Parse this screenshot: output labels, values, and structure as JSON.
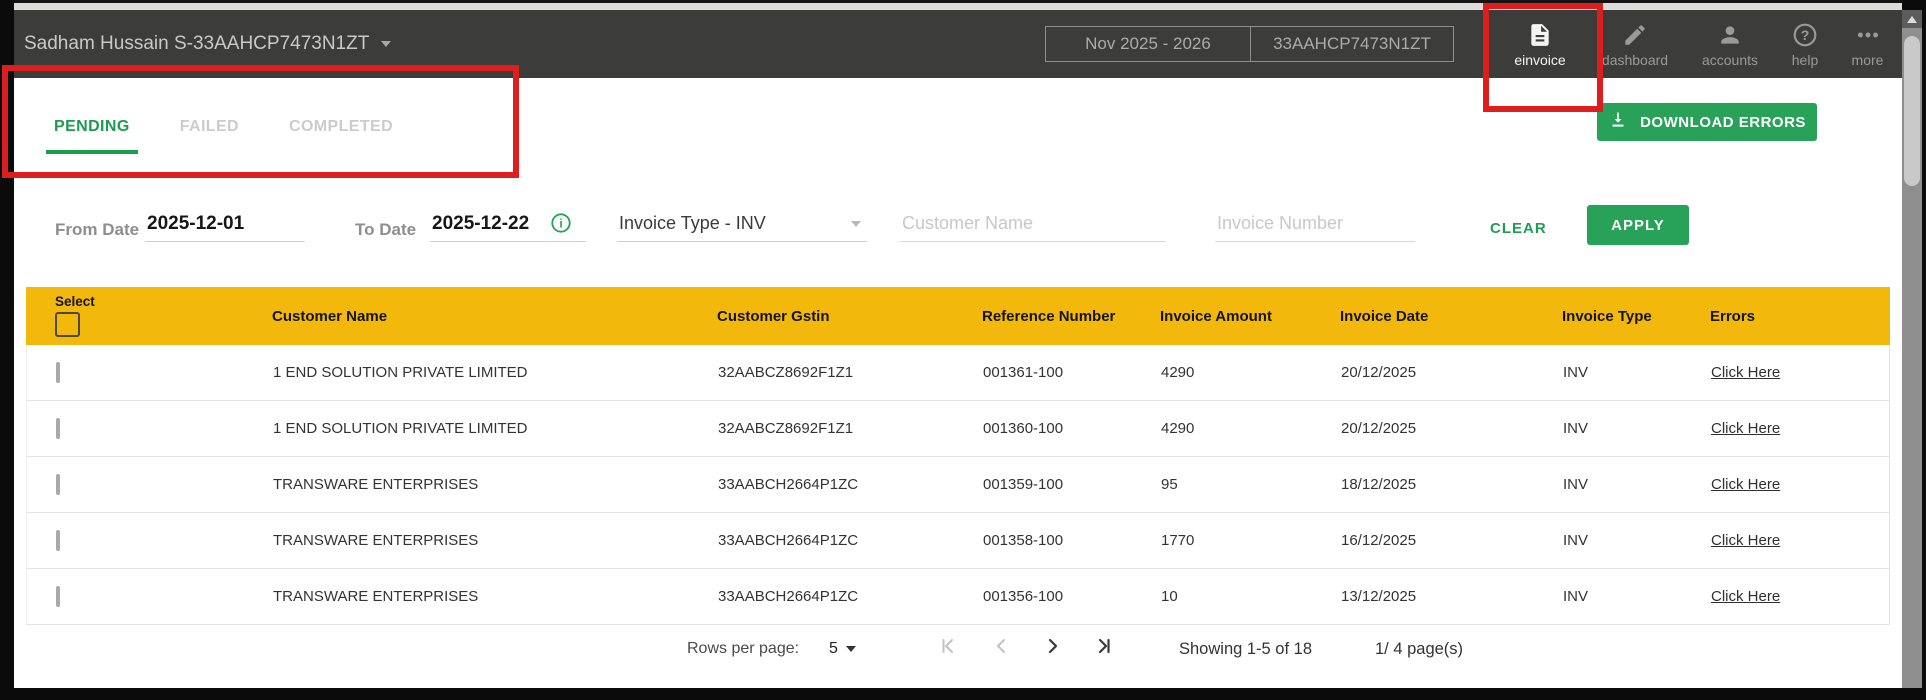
{
  "header": {
    "org_name": "Sadham Hussain S-33AAHCP7473N1ZT",
    "period": "Nov 2025 - 2026",
    "gstin": "33AAHCP7473N1ZT",
    "nav": [
      {
        "label": "einvoice",
        "icon": "document-icon",
        "active": true
      },
      {
        "label": "dashboard",
        "icon": "pencil-icon",
        "active": false
      },
      {
        "label": "accounts",
        "icon": "person-icon",
        "active": false
      },
      {
        "label": "help",
        "icon": "question-circle-icon",
        "active": false
      },
      {
        "label": "more",
        "icon": "ellipsis-icon",
        "active": false
      }
    ]
  },
  "tabs": [
    {
      "label": "PENDING",
      "active": true
    },
    {
      "label": "FAILED",
      "active": false
    },
    {
      "label": "COMPLETED",
      "active": false
    }
  ],
  "toolbar": {
    "download_errors_label": "DOWNLOAD ERRORS"
  },
  "filters": {
    "from_date_label": "From Date",
    "from_date_value": "2025-12-01",
    "to_date_label": "To Date",
    "to_date_value": "2025-12-22",
    "invoice_type_value": "Invoice Type - INV",
    "customer_name_placeholder": "Customer Name",
    "invoice_number_placeholder": "Invoice Number",
    "clear_label": "CLEAR",
    "apply_label": "APPLY"
  },
  "table": {
    "columns": [
      "Select",
      "Customer Name",
      "Customer Gstin",
      "Reference Number",
      "Invoice Amount",
      "Invoice Date",
      "Invoice Type",
      "Errors"
    ],
    "rows": [
      {
        "customer": "1 END SOLUTION PRIVATE LIMITED",
        "gstin": "32AABCZ8692F1Z1",
        "reference": "001361-100",
        "amount": "4290",
        "date": "20/12/2025",
        "type": "INV",
        "errors_link": "Click Here"
      },
      {
        "customer": "1 END SOLUTION PRIVATE LIMITED",
        "gstin": "32AABCZ8692F1Z1",
        "reference": "001360-100",
        "amount": "4290",
        "date": "20/12/2025",
        "type": "INV",
        "errors_link": "Click Here"
      },
      {
        "customer": "TRANSWARE ENTERPRISES",
        "gstin": "33AABCH2664P1ZC",
        "reference": "001359-100",
        "amount": "95",
        "date": "18/12/2025",
        "type": "INV",
        "errors_link": "Click Here"
      },
      {
        "customer": "TRANSWARE ENTERPRISES",
        "gstin": "33AABCH2664P1ZC",
        "reference": "001358-100",
        "amount": "1770",
        "date": "16/12/2025",
        "type": "INV",
        "errors_link": "Click Here"
      },
      {
        "customer": "TRANSWARE ENTERPRISES",
        "gstin": "33AABCH2664P1ZC",
        "reference": "001356-100",
        "amount": "10",
        "date": "13/12/2025",
        "type": "INV",
        "errors_link": "Click Here"
      }
    ]
  },
  "pagination": {
    "rows_per_page_label": "Rows per page:",
    "rows_per_page_value": "5",
    "showing_text": "Showing 1-5 of 18",
    "page_text": "1/ 4 page(s)"
  },
  "colors": {
    "header_dark": "#3C3C3A",
    "table_header_yellow": "#F2B80B",
    "action_green": "#27A258",
    "active_tab_green": "#1C9C4F",
    "annotation_red": "#DD1E1E"
  }
}
